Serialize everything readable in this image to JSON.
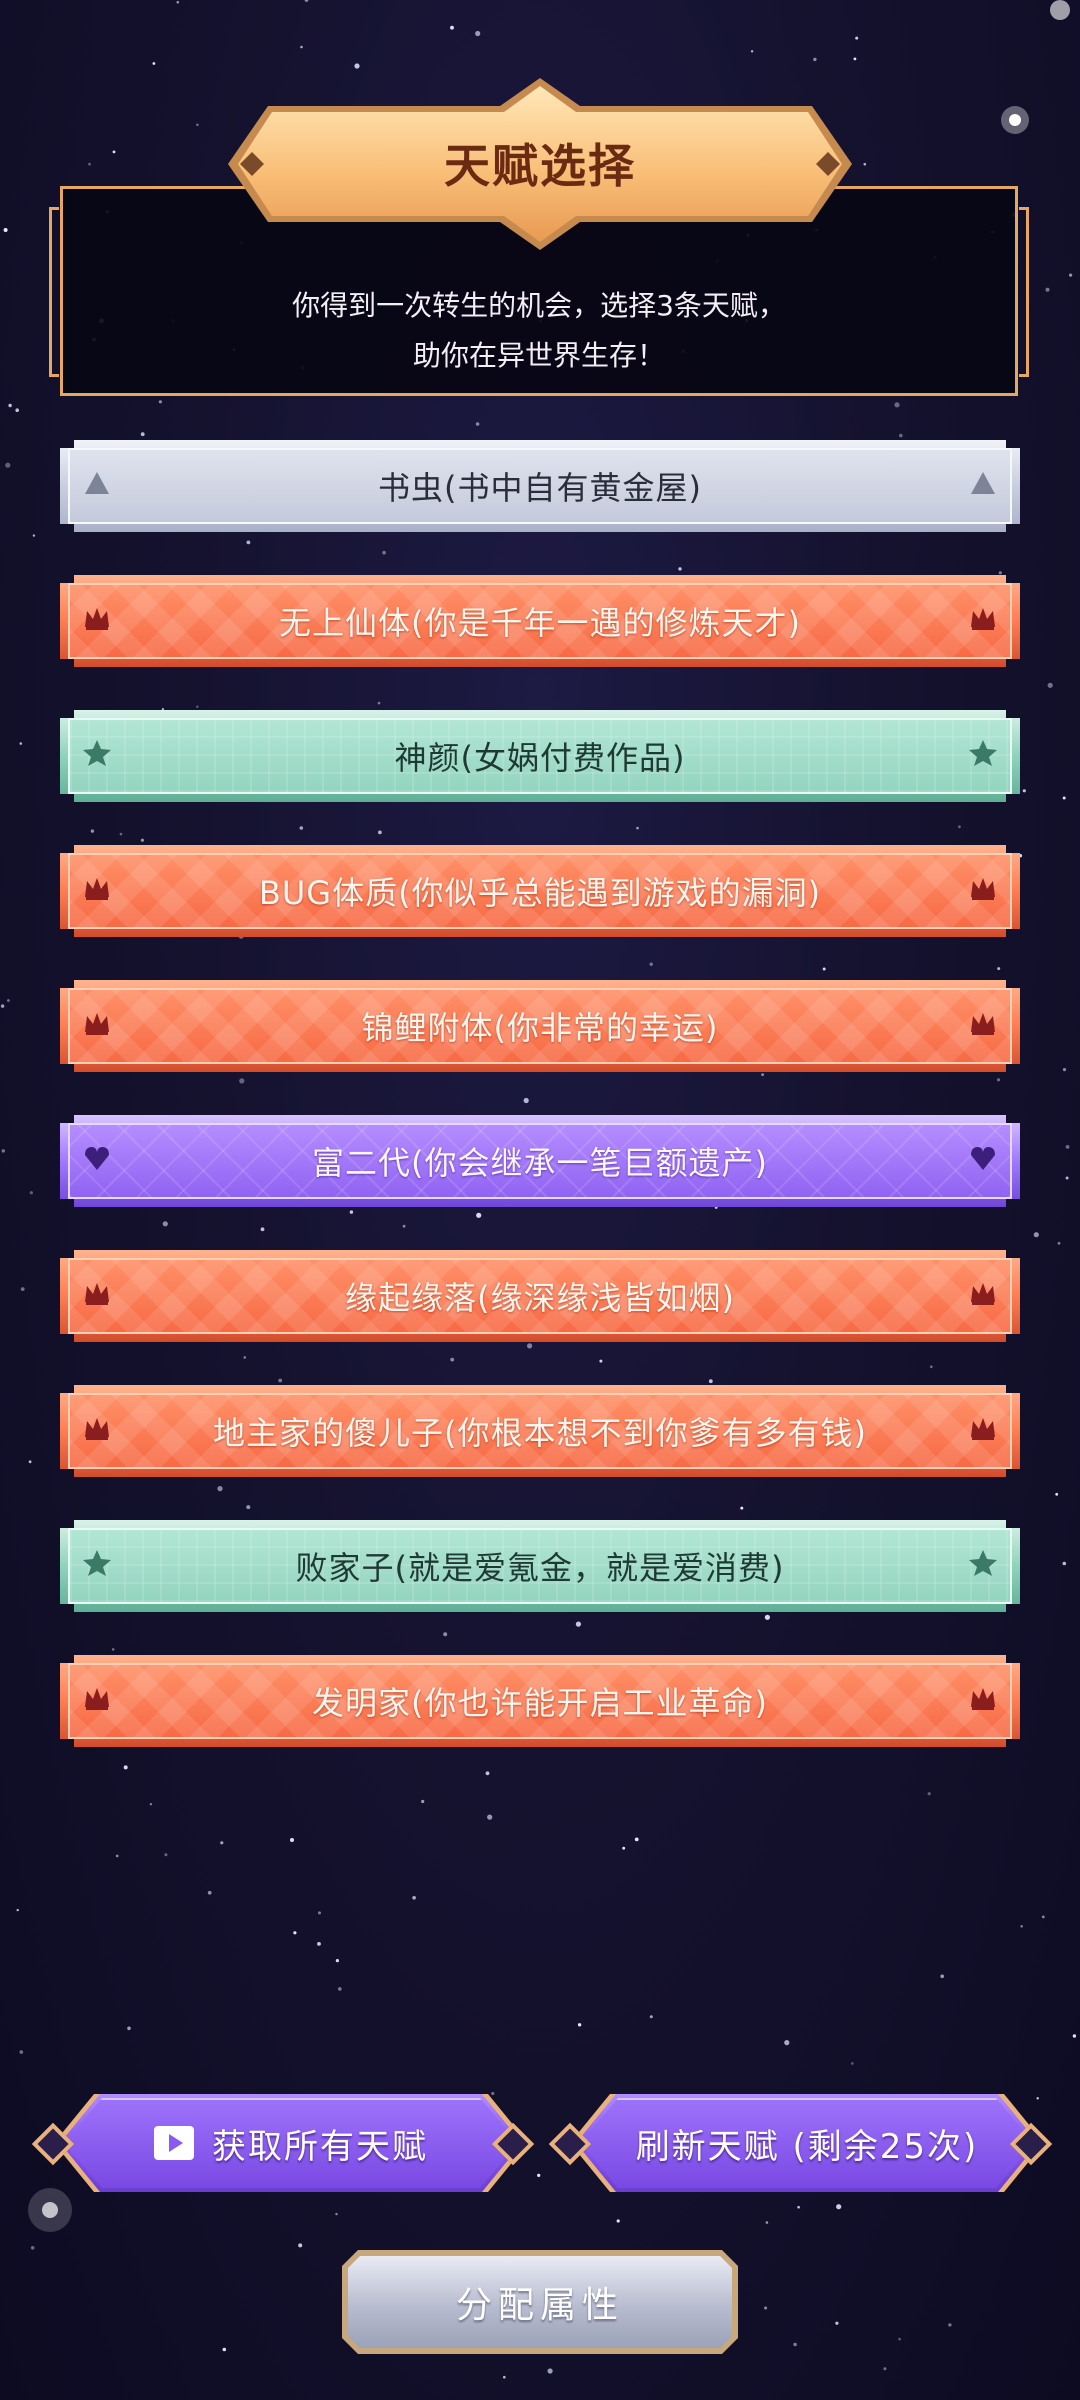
{
  "header": {
    "title": "天赋选择",
    "intro_line1": "你得到一次转生的机会，选择3条天赋，",
    "intro_line2": "助你在异世界生存！"
  },
  "talents": [
    {
      "label": "书虫(书中自有黄金屋)",
      "rarity": "common",
      "icon": "triangle-icon"
    },
    {
      "label": "无上仙体(你是千年一遇的修炼天才)",
      "rarity": "legendary",
      "icon": "crown-icon"
    },
    {
      "label": "神颜(女娲付费作品)",
      "rarity": "rare",
      "icon": "star-icon"
    },
    {
      "label": "BUG体质(你似乎总能遇到游戏的漏洞)",
      "rarity": "legendary",
      "icon": "crown-icon"
    },
    {
      "label": "锦鲤附体(你非常的幸运)",
      "rarity": "legendary",
      "icon": "crown-icon"
    },
    {
      "label": "富二代(你会继承一笔巨额遗产)",
      "rarity": "epic",
      "icon": "heart-gem-icon"
    },
    {
      "label": "缘起缘落(缘深缘浅皆如烟)",
      "rarity": "legendary",
      "icon": "crown-icon"
    },
    {
      "label": "地主家的傻儿子(你根本想不到你爹有多有钱)",
      "rarity": "legendary",
      "icon": "crown-icon"
    },
    {
      "label": "败家子(就是爱氪金，就是爱消费)",
      "rarity": "rare",
      "icon": "star-icon"
    },
    {
      "label": "发明家(你也许能开启工业革命)",
      "rarity": "legendary",
      "icon": "crown-icon"
    }
  ],
  "buttons": {
    "get_all": "获取所有天赋",
    "refresh": "刷新天赋 (剩余25次)",
    "allocate": "分配属性"
  },
  "colors": {
    "common": "#c9cfe0",
    "legendary": "#ff7d52",
    "rare": "#93d4bf",
    "epic": "#9063f2",
    "gold_border": "#e6a861",
    "background": "#15122f"
  }
}
